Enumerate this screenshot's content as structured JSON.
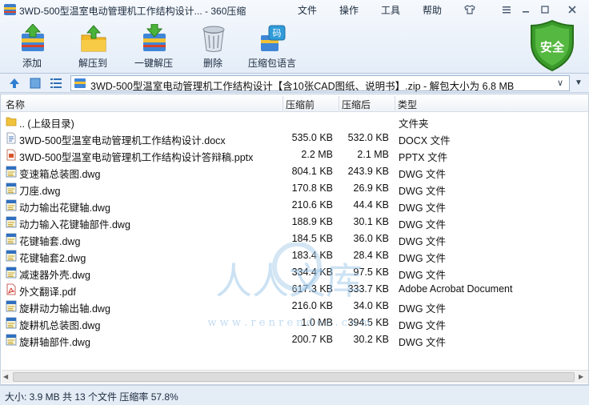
{
  "window": {
    "title": "3WD-500型温室电动管理机工作结构设计... - 360压缩",
    "menus": [
      "文件",
      "操作",
      "工具",
      "帮助"
    ],
    "controls": [
      "shirt-icon",
      "menu-icon",
      "minimize-icon",
      "maximize-icon",
      "close-icon"
    ]
  },
  "toolbar": {
    "tools": [
      {
        "label": "添加",
        "icon": "add-archive-icon"
      },
      {
        "label": "解压到",
        "icon": "extract-to-icon"
      },
      {
        "label": "一键解压",
        "icon": "quick-extract-icon"
      },
      {
        "label": "删除",
        "icon": "delete-trash-icon"
      },
      {
        "label": "压缩包语言",
        "icon": "archive-language-icon"
      }
    ],
    "safe_label": "安全",
    "safe_color": "#3a9a2a"
  },
  "address": {
    "path": "3WD-500型温室电动管理机工作结构设计【含10张CAD图纸、说明书】.zip - 解包大小为 6.8 MB"
  },
  "list": {
    "columns": [
      "名称",
      "压缩前",
      "压缩后",
      "类型"
    ],
    "rows": [
      {
        "name": ".. (上级目录)",
        "before": "",
        "after": "",
        "type": "文件夹",
        "icon": "folder-icon"
      },
      {
        "name": "3WD-500型温室电动管理机工作结构设计.docx",
        "before": "535.0 KB",
        "after": "532.0 KB",
        "type": "DOCX 文件",
        "icon": "docx-file-icon"
      },
      {
        "name": "3WD-500型温室电动管理机工作结构设计答辩稿.pptx",
        "before": "2.2 MB",
        "after": "2.1 MB",
        "type": "PPTX 文件",
        "icon": "pptx-file-icon"
      },
      {
        "name": "变速箱总装图.dwg",
        "before": "804.1 KB",
        "after": "243.9 KB",
        "type": "DWG 文件",
        "icon": "dwg-file-icon"
      },
      {
        "name": "刀座.dwg",
        "before": "170.8 KB",
        "after": "26.9 KB",
        "type": "DWG 文件",
        "icon": "dwg-file-icon"
      },
      {
        "name": "动力输出花键轴.dwg",
        "before": "210.6 KB",
        "after": "44.4 KB",
        "type": "DWG 文件",
        "icon": "dwg-file-icon"
      },
      {
        "name": "动力输入花键轴部件.dwg",
        "before": "188.9 KB",
        "after": "30.1 KB",
        "type": "DWG 文件",
        "icon": "dwg-file-icon"
      },
      {
        "name": "花键轴套.dwg",
        "before": "184.5 KB",
        "after": "36.0 KB",
        "type": "DWG 文件",
        "icon": "dwg-file-icon"
      },
      {
        "name": "花键轴套2.dwg",
        "before": "183.4 KB",
        "after": "28.4 KB",
        "type": "DWG 文件",
        "icon": "dwg-file-icon"
      },
      {
        "name": "减速器外壳.dwg",
        "before": "334.4 KB",
        "after": "97.5 KB",
        "type": "DWG 文件",
        "icon": "dwg-file-icon"
      },
      {
        "name": "外文翻译.pdf",
        "before": "617.3 KB",
        "after": "333.7 KB",
        "type": "Adobe Acrobat Document",
        "icon": "pdf-file-icon"
      },
      {
        "name": "旋耕动力输出轴.dwg",
        "before": "216.0 KB",
        "after": "34.0 KB",
        "type": "DWG 文件",
        "icon": "dwg-file-icon"
      },
      {
        "name": "旋耕机总装图.dwg",
        "before": "1.0 MB",
        "after": "394.5 KB",
        "type": "DWG 文件",
        "icon": "dwg-file-icon"
      },
      {
        "name": "旋耕轴部件.dwg",
        "before": "200.7 KB",
        "after": "30.2 KB",
        "type": "DWG 文件",
        "icon": "dwg-file-icon"
      }
    ]
  },
  "status": {
    "text": "大小: 3.9 MB 共 13 个文件 压缩率 57.8%"
  },
  "watermark": {
    "text": "人人文库",
    "url": "w w w . r e n r e n d o c . c o m"
  }
}
